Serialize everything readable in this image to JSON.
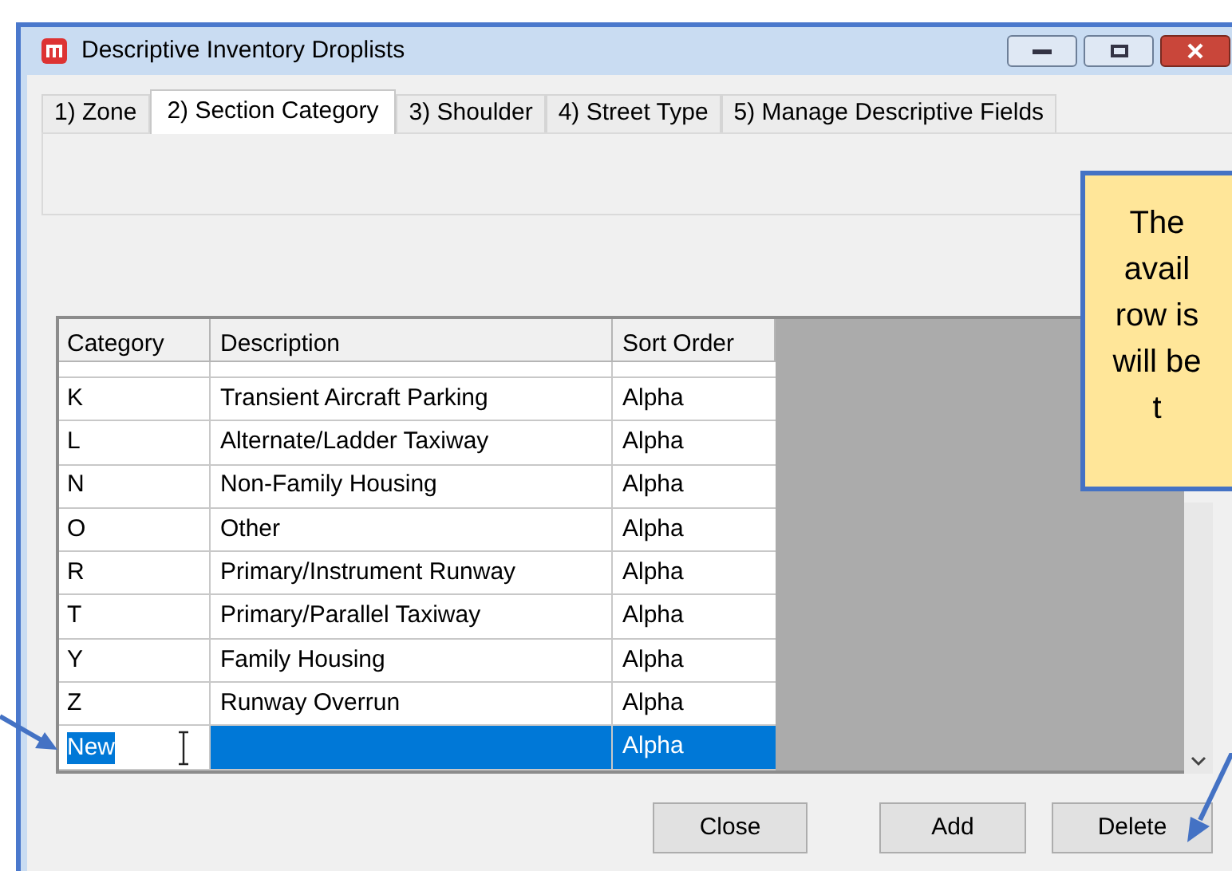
{
  "window": {
    "title": "Descriptive Inventory Droplists"
  },
  "tabs": [
    {
      "label": "1) Zone",
      "selected": false
    },
    {
      "label": "2) Section Category",
      "selected": true
    },
    {
      "label": "3) Shoulder",
      "selected": false
    },
    {
      "label": "4) Street Type",
      "selected": false
    },
    {
      "label": "5) Manage Descriptive Fields",
      "selected": false
    }
  ],
  "table": {
    "columns": [
      "Category",
      "Description",
      "Sort Order"
    ],
    "rows": [
      {
        "category": "K",
        "description": "Transient Aircraft Parking",
        "sort_order": "Alpha",
        "selected": false
      },
      {
        "category": "L",
        "description": "Alternate/Ladder Taxiway",
        "sort_order": "Alpha",
        "selected": false
      },
      {
        "category": "N",
        "description": "Non-Family Housing",
        "sort_order": "Alpha",
        "selected": false
      },
      {
        "category": "O",
        "description": "Other",
        "sort_order": "Alpha",
        "selected": false
      },
      {
        "category": "R",
        "description": "Primary/Instrument Runway",
        "sort_order": "Alpha",
        "selected": false
      },
      {
        "category": "T",
        "description": "Primary/Parallel Taxiway",
        "sort_order": "Alpha",
        "selected": false
      },
      {
        "category": "Y",
        "description": "Family Housing",
        "sort_order": "Alpha",
        "selected": false
      },
      {
        "category": "Z",
        "description": "Runway Overrun",
        "sort_order": "Alpha",
        "selected": false
      },
      {
        "category": "New",
        "description": "",
        "sort_order": "Alpha",
        "selected": true
      }
    ]
  },
  "buttons": [
    "Close",
    "Add",
    "Delete"
  ],
  "callout": {
    "lines": [
      "The",
      "avail",
      "row is",
      "will be",
      "t"
    ]
  }
}
